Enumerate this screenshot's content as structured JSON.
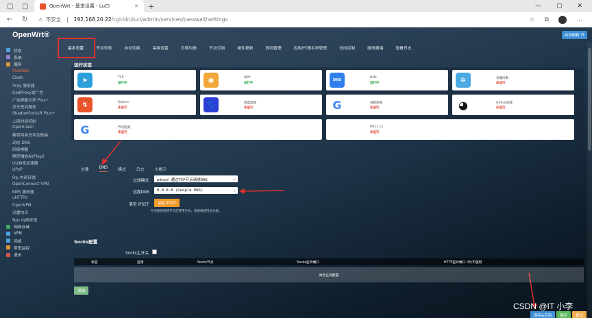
{
  "browser": {
    "tab_title": "OpenWrt - 基本设置 - LuCI",
    "close": "✕",
    "new_tab": "+",
    "insecure_label": "不安全",
    "url_host": "192.168.20.22",
    "url_path": "/cgi-bin/luci/admin/services/passwall/settings"
  },
  "header": {
    "brand": "OpenWrt®",
    "refresh_badge": "自动刷新 开"
  },
  "sidebar": {
    "items": [
      {
        "label": "状态",
        "type": "top",
        "color": "#4aa3df"
      },
      {
        "label": "系统",
        "type": "top",
        "color": "#9c7ad6"
      },
      {
        "label": "服务",
        "type": "top",
        "color": "#e0963a"
      },
      {
        "label": "PassWall",
        "type": "sub",
        "active": true
      },
      {
        "label": "Clash",
        "type": "sub"
      },
      {
        "label": "Xray 服务器",
        "type": "sub"
      },
      {
        "label": "GodProxy滤广告",
        "type": "sub"
      },
      {
        "label": "广告屏蔽大师 Plus+",
        "type": "sub"
      },
      {
        "label": "京东签到服务",
        "type": "sub"
      },
      {
        "label": "ShadowSocksR Plus+",
        "type": "sub"
      },
      {
        "label": "上网时间控制",
        "type": "sub"
      },
      {
        "label": "OpenClash",
        "type": "sub"
      },
      {
        "label": "解锁网易云灰色歌曲",
        "type": "sub"
      },
      {
        "label": "动态 DNS",
        "type": "sub"
      },
      {
        "label": "网络唤醒",
        "type": "sub"
      },
      {
        "label": "隔空播放AirPlay2",
        "type": "sub"
      },
      {
        "label": "UU游戏加速器",
        "type": "sub"
      },
      {
        "label": "UPnP",
        "type": "sub"
      },
      {
        "label": "Frp 内网穿透",
        "type": "sub"
      },
      {
        "label": "OpenConnect VPN",
        "type": "sub"
      },
      {
        "label": "KMS 服务器",
        "type": "sub"
      },
      {
        "label": "uHTTPd",
        "type": "sub"
      },
      {
        "label": "OpenVPN",
        "type": "sub"
      },
      {
        "label": "迅雷快鸟",
        "type": "sub"
      },
      {
        "label": "Nps 内网穿透",
        "type": "sub"
      },
      {
        "label": "网络存储",
        "type": "top",
        "color": "#3fa86b"
      },
      {
        "label": "VPN",
        "type": "top",
        "color": "#4aa3df"
      },
      {
        "label": "网络",
        "type": "top",
        "color": "#4aa3df"
      },
      {
        "label": "带宽监控",
        "type": "top",
        "color": "#e0963a"
      },
      {
        "label": "退出",
        "type": "top",
        "color": "#d9534f"
      }
    ]
  },
  "tabs": [
    "基本设置",
    "节点列表",
    "自动切换",
    "高级设置",
    "负载均衡",
    "节点订阅",
    "组件更新",
    "规则管理",
    "应用/代理名单管理",
    "访问控制",
    "服务器端",
    "查看日志"
  ],
  "status": {
    "title": "运行状态",
    "cards": [
      {
        "name": "TCP",
        "state": "运行中",
        "ok": true,
        "icon": "telegram-icon",
        "color": "#2b9fd9",
        "glyph": "➤"
      },
      {
        "name": "UDP",
        "state": "运行中",
        "ok": true,
        "icon": "gamepad-icon",
        "color": "#f2a73a",
        "glyph": "◉"
      },
      {
        "name": "DNS",
        "state": "运行中",
        "ok": true,
        "icon": "dns-icon",
        "color": "#2f80ed",
        "glyph": "DNS"
      },
      {
        "name": "负载均衡",
        "state": "未运行",
        "ok": false,
        "icon": "snowflake-icon",
        "color": "#4aa9e0",
        "glyph": "✲"
      },
      {
        "name": "Kcptun",
        "state": "未运行",
        "ok": false,
        "icon": "kcptun-icon",
        "color": "#e8542c",
        "glyph": "↯"
      },
      {
        "name": "百度连接",
        "state": "未运行",
        "ok": false,
        "icon": "paw-icon",
        "color": "#2b3fd6",
        "glyph": "🐾"
      },
      {
        "name": "谷歌连接",
        "state": "未运行",
        "ok": false,
        "icon": "google-icon",
        "color": "#ffffff",
        "glyph": "G"
      },
      {
        "name": "Github连接",
        "state": "未运行",
        "ok": false,
        "icon": "github-icon",
        "color": "#ffffff",
        "glyph": "◕"
      },
      {
        "name": "节点检测",
        "state": "未运行",
        "ok": false,
        "icon": "google-icon",
        "color": "#ffffff",
        "glyph": "G"
      },
      {
        "name": "IP111.cn",
        "state": "未运行",
        "ok": false,
        "icon": "ip-icon",
        "color": "#ffffff",
        "glyph": ""
      }
    ]
  },
  "subtabs": [
    "主要",
    "DNS",
    "模式",
    "日志",
    "小提示"
  ],
  "form": {
    "filter_mode_label": "过滤模式",
    "filter_mode_value": "pdnsd 通过TCP节点请求DNS",
    "remote_dns_label": "远程DNS",
    "remote_dns_value": "8.8.8.8 (Google DNS)",
    "clear_ipset_label": "清空 IPSET",
    "clear_ipset_button": "清除 IPSET",
    "clear_ipset_hint": "在切换规则或节点后使用生效，请谨慎使用此功能。"
  },
  "socks": {
    "title": "Socks配置",
    "switch_label": "Socks主开关",
    "headers": [
      "状态",
      "启用",
      "Socks节点",
      "Socks监听端口",
      "HTTP监听端口 0为不使用"
    ],
    "empty": "尚无任何配置",
    "add_button": "添加"
  },
  "footer": {
    "save_apply": "保存&应用",
    "save": "保存",
    "reset": "复位"
  },
  "watermark": "CSDN @IT 小李"
}
